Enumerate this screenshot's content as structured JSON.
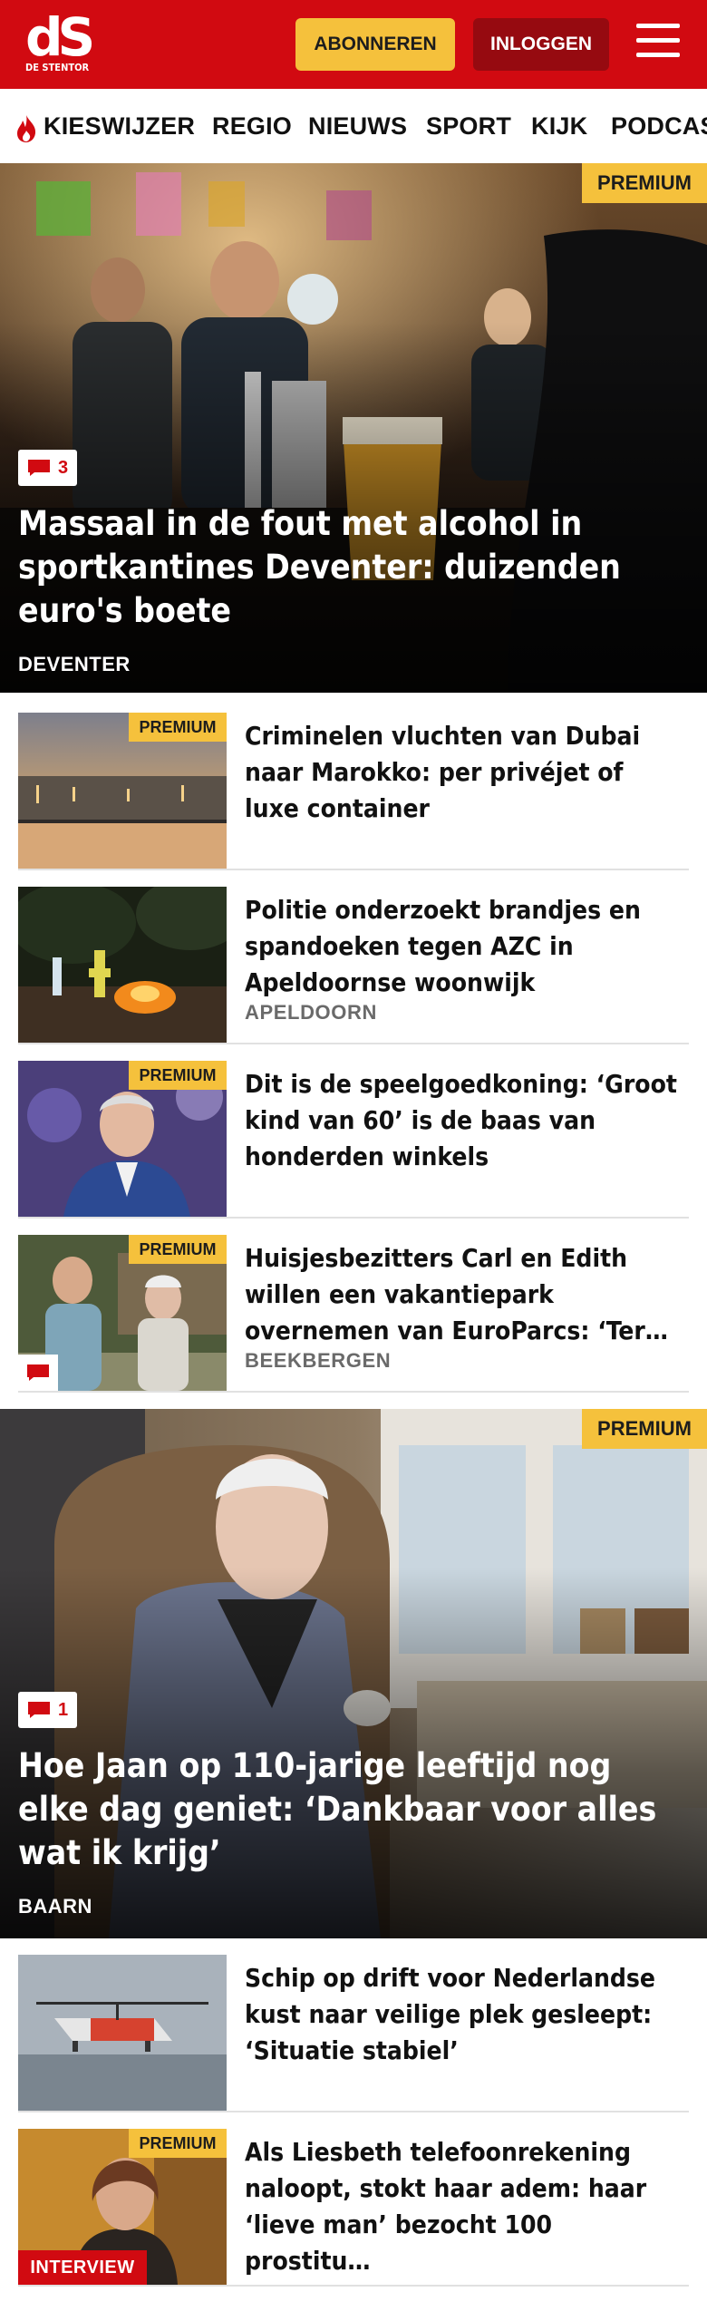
{
  "header": {
    "logo_mark": "dS",
    "logo_sub": "DE STENTOR",
    "subscribe_label": "ABONNEREN",
    "login_label": "INLOGGEN",
    "menu_icon": "hamburger-icon"
  },
  "nav": {
    "items": [
      "KIESWIJZER",
      "REGIO",
      "NIEUWS",
      "SPORT",
      "KIJK",
      "PODCAS"
    ],
    "flame_icon": "flame-icon"
  },
  "premium_label": "PREMIUM",
  "hero1": {
    "comment_count": "3",
    "title": "Massaal in de fout met alcohol in sportkantines Deventer: duizenden euro's boete",
    "location": "DEVENTER"
  },
  "articles1": [
    {
      "title": "Criminelen vluchten van Dubai naar Marokko: per privéjet of luxe container",
      "location": "",
      "premium": true
    },
    {
      "title": "Politie onderzoekt brandjes en spandoeken tegen AZC in Apeldoornse woonwijk",
      "location": "APELDOORN",
      "premium": false
    },
    {
      "title": "Dit is de speelgoedkoning: ‘Groot kind van 60’ is de baas van honderden winkels",
      "location": "",
      "premium": true
    },
    {
      "title": "Huisjesbezitters Carl en Edith willen een vakantiepark overnemen van EuroParcs: ‘Ter…",
      "location": "BEEKBERGEN",
      "premium": true
    }
  ],
  "hero2": {
    "comment_count": "1",
    "title": "Hoe Jaan op 110-jarige leeftijd nog elke dag geniet: ‘Dankbaar voor alles wat ik krijg’",
    "location": "BAARN"
  },
  "articles2": [
    {
      "title": "Schip op drift voor Nederlandse kust naar veilige plek gesleept: ‘Situatie stabiel’",
      "location": "",
      "premium": false
    },
    {
      "title": "Als Liesbeth telefoonrekening naloopt, stokt haar adem: haar ‘lieve man’ bezocht 100 prostitu…",
      "location": "",
      "premium": true,
      "tag": "INTERVIEW"
    }
  ],
  "colors": {
    "brand_red": "#d10a11",
    "premium_yellow": "#f5c13c",
    "dark_red": "#960a10"
  }
}
